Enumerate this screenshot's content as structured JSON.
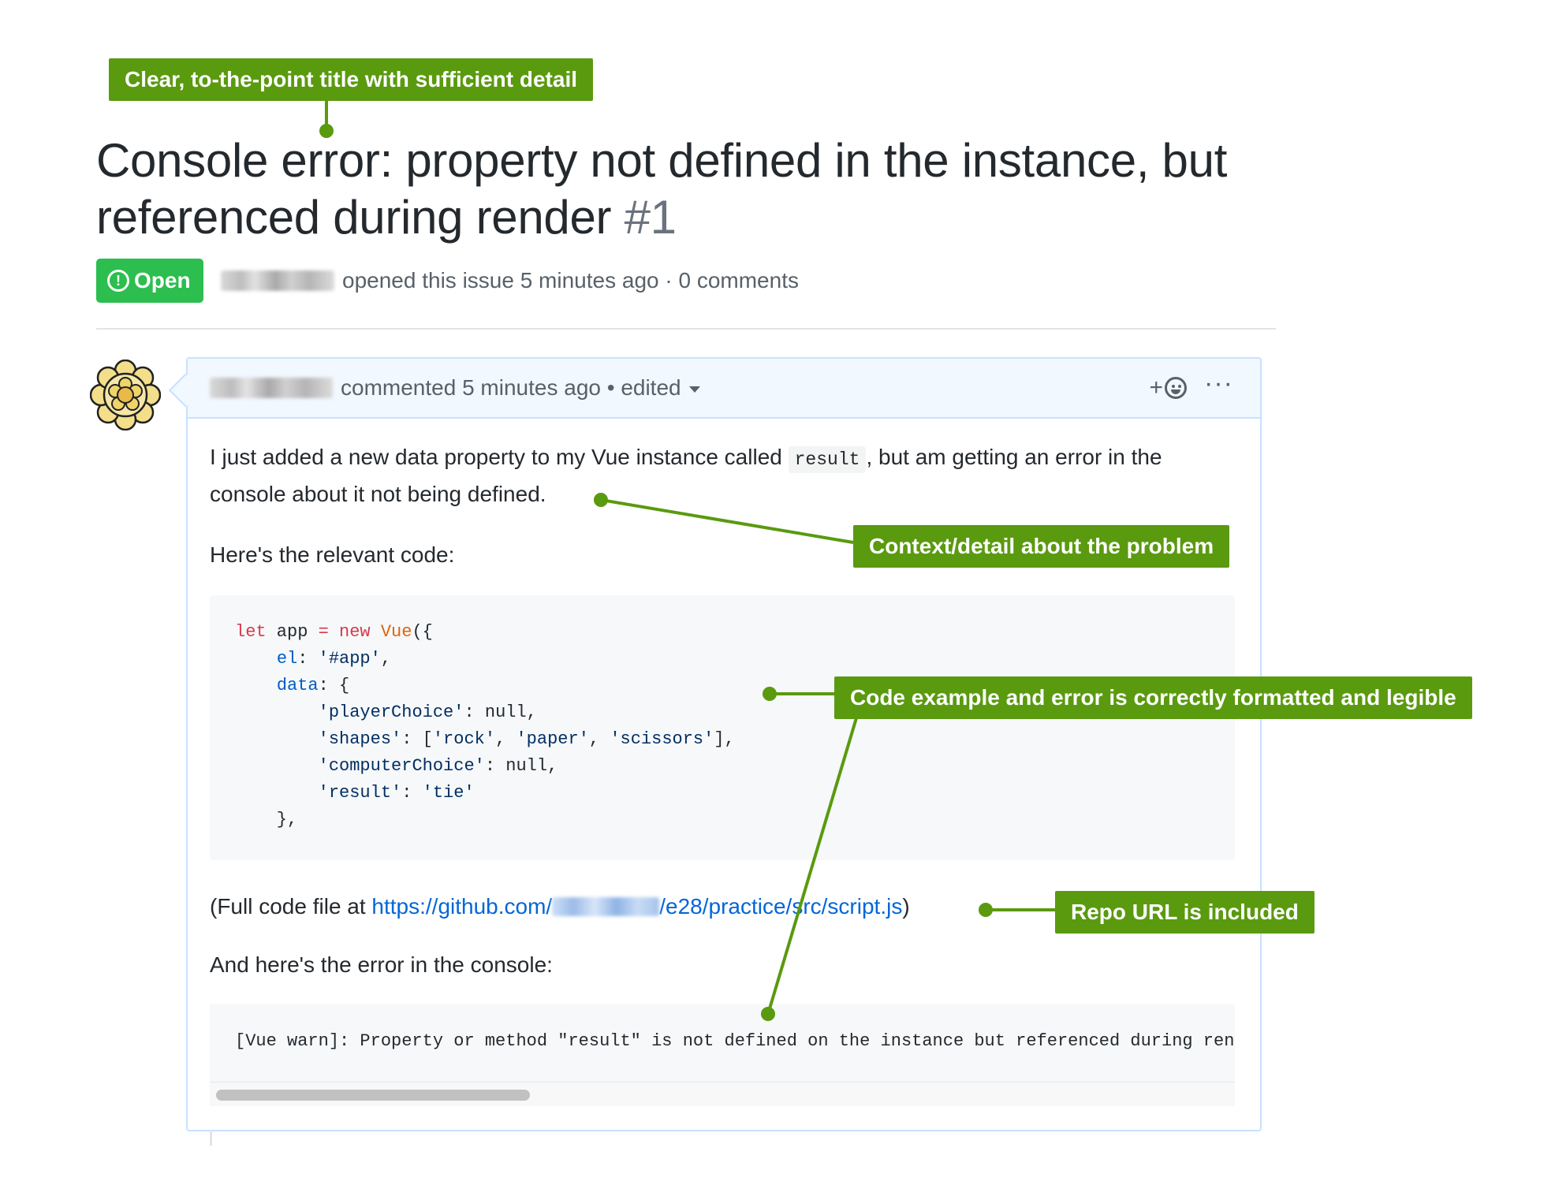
{
  "issue": {
    "title": "Console error: property not defined in the instance, but referenced during render",
    "number": "#1",
    "state": "Open",
    "meta": "opened this issue 5 minutes ago · 0 comments"
  },
  "comment": {
    "header_text": "commented 5 minutes ago • edited",
    "intro_before": "I just added a new data property to my Vue instance called ",
    "intro_code": "result",
    "intro_after": ", but am getting an error in the console about it not being defined.",
    "relevant_code_label": "Here's the relevant code:",
    "code_lines": [
      "let app = new Vue({",
      "    el: '#app',",
      "    data: {",
      "        'playerChoice': null,",
      "        'shapes': ['rock', 'paper', 'scissors'],",
      "        'computerChoice': null,",
      "        'result': 'tie'",
      "    },"
    ],
    "full_file_prefix": "(Full code file at ",
    "url_start": "https://github.com/",
    "url_end": "/e28/practice/src/script.js",
    "full_file_suffix": ")",
    "error_label": "And here's the error in the console:",
    "error_text": "[Vue warn]: Property or method \"result\" is not defined on the instance but referenced during render"
  },
  "annotations": {
    "title_note": "Clear, to-the-point title with sufficient detail",
    "context_note": "Context/detail about the problem",
    "code_note": "Code example and error is correctly formatted and legible",
    "repo_note": "Repo URL is included"
  },
  "icons": {
    "state": "issue-opened-icon",
    "reaction": "smiley-icon",
    "menu": "kebab-horizontal-icon",
    "dropdown": "triangle-down-icon"
  },
  "colors": {
    "annotation_green": "#5a9a0f",
    "open_badge": "#2cbe4e",
    "link_blue": "#0366d6",
    "comment_border": "#c8e1ff",
    "comment_header_bg": "#f1f8ff"
  }
}
